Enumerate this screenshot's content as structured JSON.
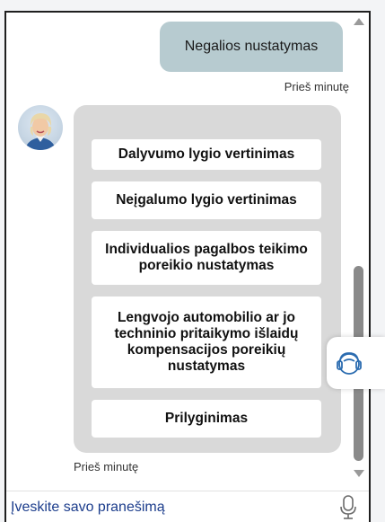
{
  "chat": {
    "user_message": "Negalios nustatymas",
    "user_time": "Prieš minutę",
    "bot_time": "Prieš minutę",
    "options": [
      {
        "label": "Dalyvumo lygio vertinimas"
      },
      {
        "label": "Neįgalumo lygio vertinimas"
      },
      {
        "label": "Individualios pagalbos teikimo poreikio nustatymas"
      },
      {
        "label": "Lengvojo automobilio ar jo techninio pritaikymo išlaidų kompensacijos poreikių nustatymas"
      },
      {
        "label": "Prilyginimas"
      }
    ]
  },
  "input": {
    "placeholder": "Įveskite savo pranešimą"
  },
  "icons": {
    "avatar": "assistant-avatar",
    "mic": "microphone-icon",
    "support": "headset-icon",
    "scroll_up": "chevron-up-icon",
    "scroll_down": "chevron-down-icon"
  },
  "colors": {
    "user_bubble": "#b7cbd0",
    "options_panel": "#d9d9d9",
    "input_text": "#1c3d8c",
    "support_icon": "#2b6cb0"
  }
}
